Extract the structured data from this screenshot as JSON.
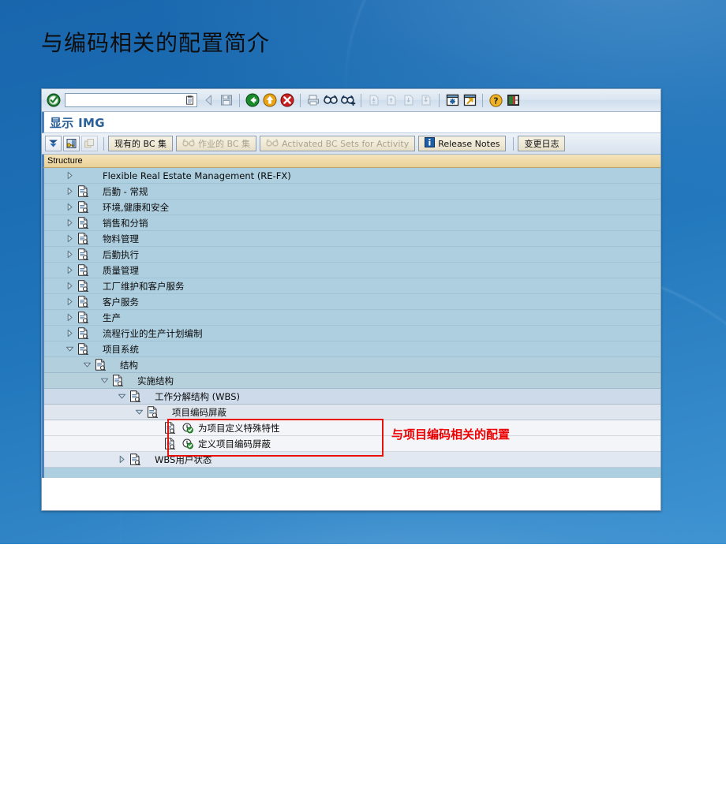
{
  "slide": {
    "title": "与编码相关的配置简介",
    "background_color": "#1f74ba",
    "title_color": "#0d0d0d"
  },
  "sap_window": {
    "command_field": {
      "value": "",
      "placeholder": ""
    },
    "toolbar_icons": [
      "enter-check-icon",
      "back-arrow-icon",
      "save-disk-icon",
      "back-green-icon",
      "exit-yellow-icon",
      "cancel-red-icon",
      "print-icon",
      "find-icon",
      "find-next-icon",
      "first-page-icon",
      "previous-page-icon",
      "next-page-icon",
      "last-page-icon",
      "new-session-icon",
      "create-shortcut-icon",
      "help-icon",
      "customize-layout-icon"
    ],
    "screen_title": "显示 IMG",
    "button_row": {
      "icon_buttons": [
        {
          "name": "collapse-all-icon",
          "enabled": true
        },
        {
          "name": "display-key-icon",
          "enabled": true
        },
        {
          "name": "copy-disabled-icon",
          "enabled": false
        }
      ],
      "buttons": [
        {
          "label": "现有的 BC 集",
          "icon": "glasses-icon",
          "enabled": true,
          "show_icon": false
        },
        {
          "label": "作业的 BC 集",
          "icon": "glasses-icon",
          "enabled": false,
          "show_icon": true
        },
        {
          "label": "Activated BC Sets for Activity",
          "icon": "glasses-icon",
          "enabled": false,
          "show_icon": true
        },
        {
          "label": "Release Notes",
          "icon": "info-blue-icon",
          "enabled": true,
          "show_icon": true
        },
        {
          "label": "变更日志",
          "icon": "",
          "enabled": true,
          "show_icon": false
        }
      ]
    },
    "structure_header": "Structure",
    "tree": [
      {
        "label": "Flexible Real Estate Management (RE-FX)",
        "depth": 0,
        "state": "collapsed",
        "icon": "none",
        "row_shade": "d0"
      },
      {
        "label": "后勤 - 常规",
        "depth": 0,
        "state": "collapsed",
        "icon": "img-doc",
        "row_shade": "d0"
      },
      {
        "label": "环境,健康和安全",
        "depth": 0,
        "state": "collapsed",
        "icon": "img-doc",
        "row_shade": "d0"
      },
      {
        "label": "销售和分销",
        "depth": 0,
        "state": "collapsed",
        "icon": "img-doc",
        "row_shade": "d0"
      },
      {
        "label": "物料管理",
        "depth": 0,
        "state": "collapsed",
        "icon": "img-doc",
        "row_shade": "d0"
      },
      {
        "label": "后勤执行",
        "depth": 0,
        "state": "collapsed",
        "icon": "img-doc",
        "row_shade": "d0"
      },
      {
        "label": "质量管理",
        "depth": 0,
        "state": "collapsed",
        "icon": "img-doc",
        "row_shade": "d0"
      },
      {
        "label": "工厂维护和客户服务",
        "depth": 0,
        "state": "collapsed",
        "icon": "img-doc",
        "row_shade": "d0"
      },
      {
        "label": "客户服务",
        "depth": 0,
        "state": "collapsed",
        "icon": "img-doc",
        "row_shade": "d0"
      },
      {
        "label": "生产",
        "depth": 0,
        "state": "collapsed",
        "icon": "img-doc",
        "row_shade": "d0"
      },
      {
        "label": "流程行业的生产计划编制",
        "depth": 0,
        "state": "collapsed",
        "icon": "img-doc",
        "row_shade": "d0"
      },
      {
        "label": "项目系统",
        "depth": 0,
        "state": "expanded",
        "icon": "img-doc",
        "row_shade": "d0"
      },
      {
        "label": "结构",
        "depth": 1,
        "state": "expanded",
        "icon": "img-doc",
        "row_shade": "d1"
      },
      {
        "label": "实施结构",
        "depth": 2,
        "state": "expanded",
        "icon": "img-doc",
        "row_shade": "d2"
      },
      {
        "label": "工作分解结构 (WBS)",
        "depth": 3,
        "state": "expanded",
        "icon": "img-doc",
        "row_shade": "d3"
      },
      {
        "label": "项目编码屏蔽",
        "depth": 4,
        "state": "expanded",
        "icon": "img-doc",
        "row_shade": "d4"
      },
      {
        "label": "为项目定义特殊特性",
        "depth": 5,
        "state": "leaf",
        "icon": "activity",
        "row_shade": "d5"
      },
      {
        "label": "定义项目编码屏蔽",
        "depth": 5,
        "state": "leaf",
        "icon": "activity",
        "row_shade": "d5"
      },
      {
        "label": "WBS用户状态",
        "depth": 3,
        "state": "collapsed",
        "icon": "img-doc",
        "row_shade": "d6"
      }
    ]
  },
  "annotation": {
    "text": "与项目编码相关的配置",
    "color": "#ee0000",
    "box_color": "#e8110c"
  }
}
